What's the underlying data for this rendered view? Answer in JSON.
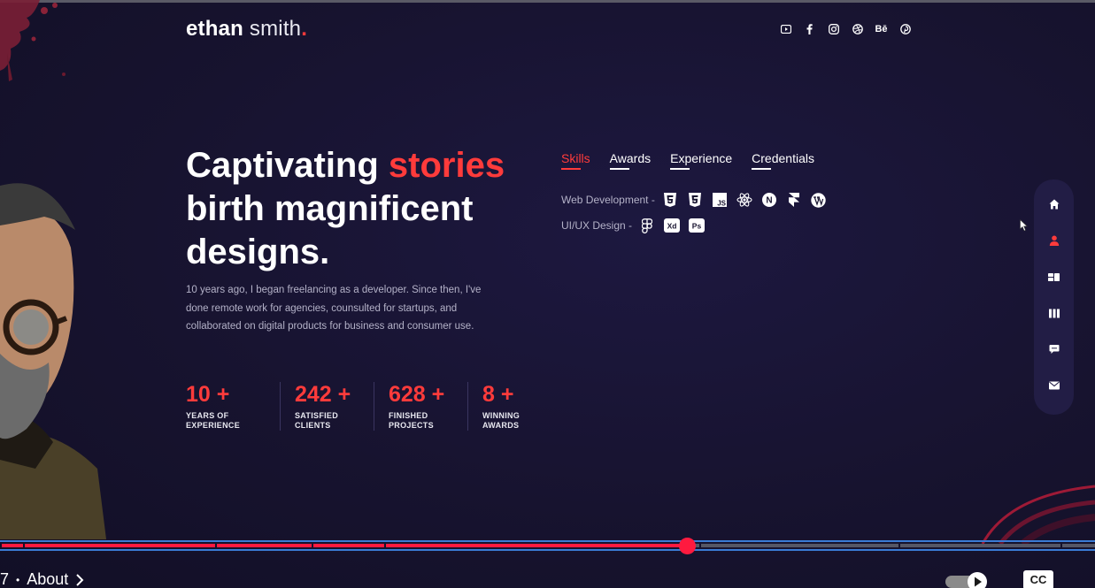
{
  "logo": {
    "first": "ethan",
    "last": "smith",
    "dot": "."
  },
  "social_icons": [
    "youtube-icon",
    "facebook-icon",
    "instagram-icon",
    "dribbble-icon",
    "behance-icon",
    "pinterest-icon"
  ],
  "social_behance_text": "Bē",
  "headline": {
    "line1_start": "Captivating ",
    "line1_accent": "stories",
    "line2": "birth magnificent",
    "line3": "designs."
  },
  "intro": "10 years ago, I began freelancing as a developer. Since then, I've done remote work for agencies, counsulted for startups, and collaborated on digital products for business and consumer use.",
  "stats": [
    {
      "value": "10 +",
      "label": "YEARS OF EXPERIENCE"
    },
    {
      "value": "242 +",
      "label": "SATISFIED CLIENTS"
    },
    {
      "value": "628 +",
      "label": "FINISHED PROJECTS"
    },
    {
      "value": "8 +",
      "label": "WINNING AWARDS"
    }
  ],
  "tabs": [
    {
      "label": "Skills",
      "active": true
    },
    {
      "label": "Awards",
      "active": false
    },
    {
      "label": "Experience",
      "active": false
    },
    {
      "label": "Credentials",
      "active": false
    }
  ],
  "skills": [
    {
      "label": "Web Development -",
      "icons": [
        "html5-icon",
        "css3-icon",
        "javascript-icon",
        "react-icon",
        "nextjs-icon",
        "framer-icon",
        "wordpress-icon"
      ]
    },
    {
      "label": "UI/UX Design -",
      "icons": [
        "figma-icon",
        "adobe-xd-icon",
        "photoshop-icon"
      ]
    }
  ],
  "icon_text": {
    "js": "JS",
    "next": "N",
    "xd": "Xd",
    "ps": "Ps"
  },
  "sidenav": [
    {
      "icon": "home-icon",
      "active": false
    },
    {
      "icon": "user-icon",
      "active": true
    },
    {
      "icon": "services-icon",
      "active": false
    },
    {
      "icon": "work-icon",
      "active": false
    },
    {
      "icon": "testimonials-icon",
      "active": false
    },
    {
      "icon": "contact-icon",
      "active": false
    }
  ],
  "colors": {
    "accent": "#ff3b3b",
    "background": "#17132f",
    "nav_bg": "#221d45",
    "muted_text": "#b4b2c8",
    "progress_played": "#ff1a3f"
  },
  "video": {
    "progress_fraction": 0.627,
    "chapter_number": "7",
    "chapter_separator": "•",
    "chapter_title": "About",
    "cc_label": "CC"
  }
}
